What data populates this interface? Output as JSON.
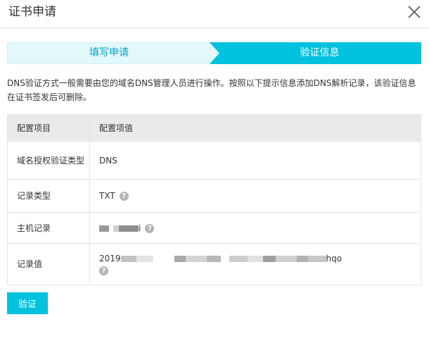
{
  "dialog": {
    "title": "证书申请"
  },
  "steps": [
    {
      "label": "填写申请",
      "state": "done"
    },
    {
      "label": "验证信息",
      "state": "active"
    }
  ],
  "description": "DNS验证方式一般需要由您的域名DNS管理人员进行操作。按照以下提示信息添加DNS解析记录，该验证信息在证书签发后可删除。",
  "table": {
    "headers": [
      "配置项目",
      "配置项值"
    ],
    "rows": [
      {
        "item": "域名授权验证类型",
        "value": "DNS",
        "help": false
      },
      {
        "item": "记录类型",
        "value": "TXT",
        "help": true
      },
      {
        "item": "主机记录",
        "value_suffix": "i",
        "masked": true,
        "help": true
      },
      {
        "item": "记录值",
        "value_prefix": "2019",
        "value_suffix": "hqo",
        "masked": true,
        "help": true
      }
    ]
  },
  "buttons": {
    "verify": "验证"
  },
  "icons": {
    "close": "close-icon",
    "help": "help-icon"
  },
  "colors": {
    "accent": "#00c1de",
    "step_done_bg": "#e3f8fb",
    "step_done_text": "#00a2ca",
    "header_bg": "#eaeaea"
  }
}
